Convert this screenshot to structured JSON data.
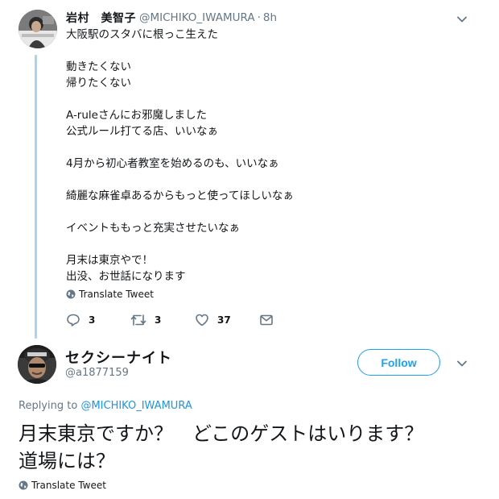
{
  "parent_tweet": {
    "author_name": "岩村　美智子",
    "author_handle": "@MICHIKO_IWAMURA",
    "separator": "·",
    "timestamp": "8h",
    "text_lines": [
      "大阪駅のスタバに根っこ生えた",
      "",
      "動きたくない",
      "帰りたくない",
      "",
      "A-ruleさんにお邪魔しました",
      "公式ルール打てる店、いいなぁ",
      "",
      "4月から初心者教室を始めるのも、いいなぁ",
      "",
      "綺麗な麻雀卓あるからもっと使ってほしいなぁ",
      "",
      "イベントももっと充実させたいなぁ",
      "",
      "月末は東京やで！",
      "出没、お世話になります"
    ],
    "translate_label": "Translate Tweet",
    "actions": {
      "reply_count": "3",
      "retweet_count": "3",
      "like_count": "37"
    }
  },
  "reply_tweet": {
    "author_name": "セクシーナイト",
    "author_handle": "@a1877159",
    "follow_label": "Follow",
    "replying_to_prefix": "Replying to ",
    "replying_to_mention": "@MICHIKO_IWAMURA",
    "text": "月末東京ですか？　どこのゲストはいります？　道場には？",
    "translate_label": "Translate Tweet"
  },
  "colors": {
    "accent": "#1da1f2",
    "mention": "#1b95e0",
    "secondary_text": "#657786",
    "thread_line": "#a6d4f2"
  },
  "icons": [
    "reply-icon",
    "retweet-icon",
    "like-icon",
    "direct-message-icon",
    "globe-icon",
    "chevron-down-icon"
  ]
}
